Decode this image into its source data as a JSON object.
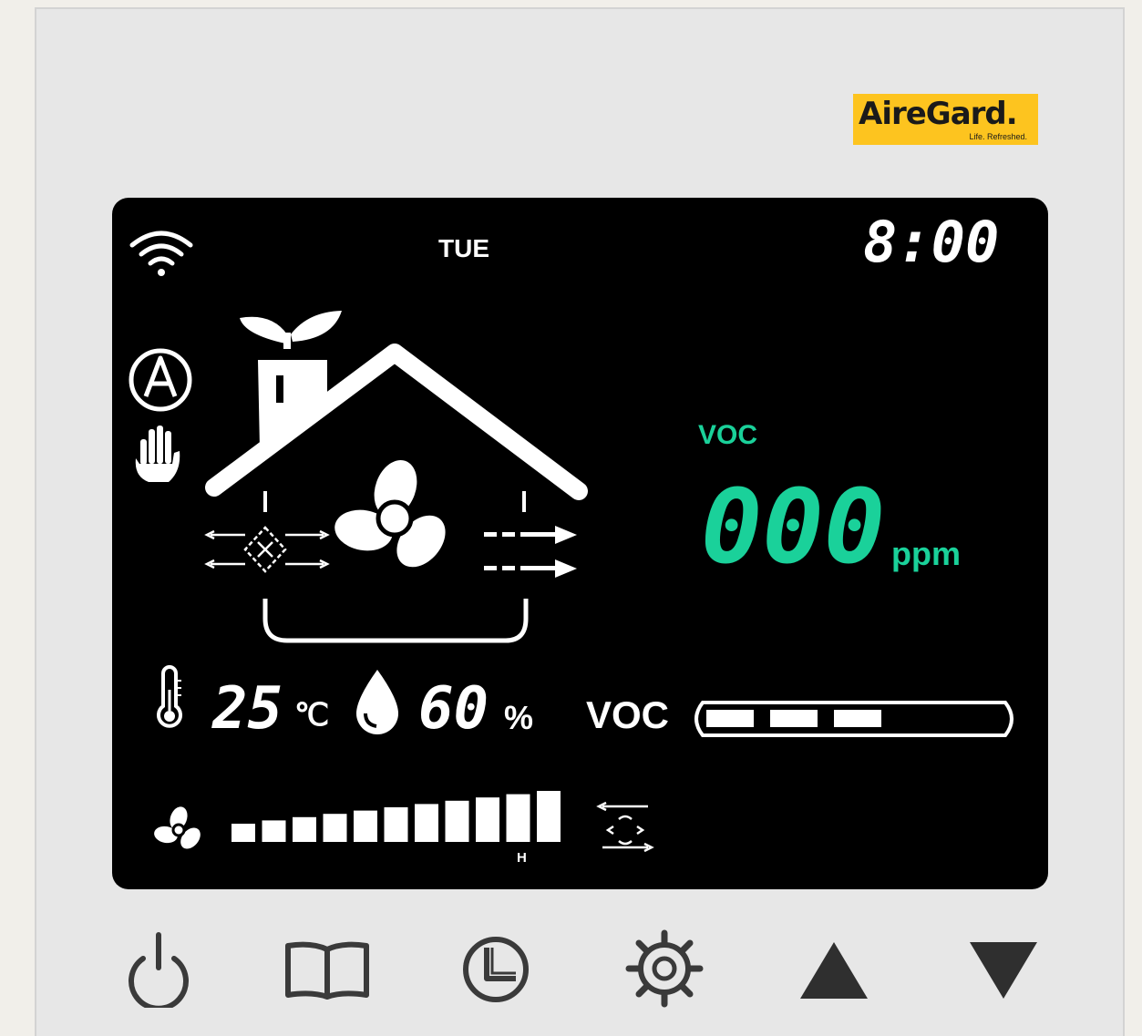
{
  "brand": {
    "name": "AireGard.",
    "tagline": "Life. Refreshed.",
    "color": "#fdc41f"
  },
  "display": {
    "day": "TUE",
    "time": "8:00",
    "voc_title": "VOC",
    "voc_value": "000",
    "voc_unit": "ppm",
    "temperature": "25",
    "temperature_unit": "℃",
    "humidity": "60",
    "humidity_unit": "%",
    "voc_bar_label": "VOC",
    "voc_level_segments": 3,
    "fan_speed_label": "H",
    "fan_speed_levels": 11,
    "accent_color": "#1ad19a"
  },
  "icons": {
    "status": [
      "wifi-icon",
      "auto-mode-icon",
      "manual-mode-icon"
    ],
    "house": [
      "leaf-icon",
      "house-icon",
      "heat-exchanger-icon",
      "fan-icon",
      "exhaust-arrows-icon"
    ],
    "readings": [
      "thermometer-icon",
      "water-drop-icon"
    ]
  },
  "buttons": [
    {
      "name": "power-button",
      "icon": "power-icon"
    },
    {
      "name": "mode-button",
      "icon": "book-icon"
    },
    {
      "name": "timer-button",
      "icon": "clock-icon"
    },
    {
      "name": "settings-button",
      "icon": "gear-icon"
    },
    {
      "name": "up-button",
      "icon": "triangle-up-icon"
    },
    {
      "name": "down-button",
      "icon": "triangle-down-icon"
    }
  ]
}
